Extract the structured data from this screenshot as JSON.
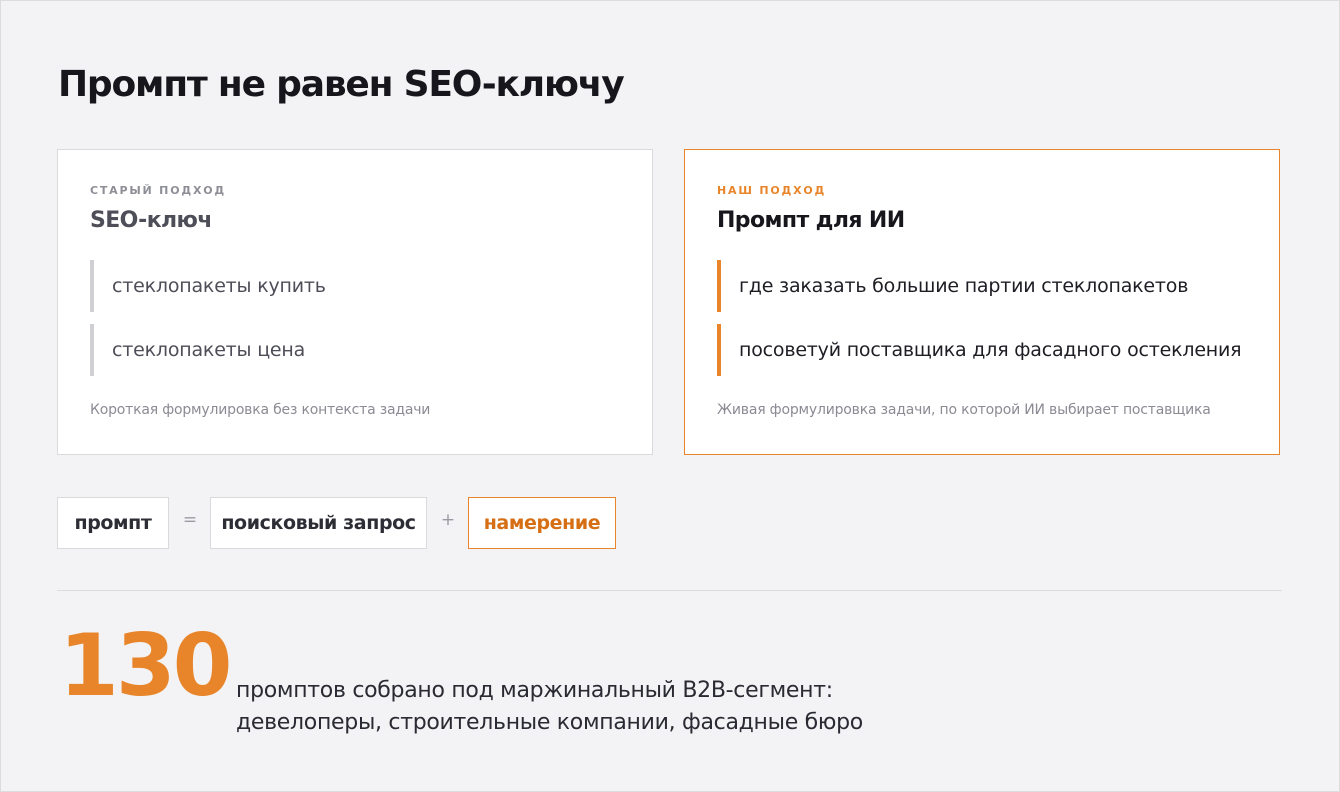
{
  "title": "Промпт не равен SEO-ключу",
  "old_approach": {
    "kicker": "СТАРЫЙ ПОДХОД",
    "title": "SEO-ключ",
    "examples": [
      "стеклопакеты купить",
      "стеклопакеты цена"
    ],
    "note": "Короткая формулировка без контекста задачи"
  },
  "new_approach": {
    "kicker": "НАШ ПОДХОД",
    "title": "Промпт для ИИ",
    "examples": [
      "где заказать большие партии стеклопакетов",
      "посоветуй поставщика для фасадного остекления"
    ],
    "note": "Живая формулировка задачи, по которой ИИ выбирает поставщика"
  },
  "formula": {
    "term1": "промпт",
    "op1": "=",
    "term2": "поисковый запрос",
    "op2": "+",
    "term3": "намерение"
  },
  "stat": {
    "number": "130",
    "line1": "промптов собрано под маржинальный B2B-сегмент:",
    "line2": "девелоперы, строительные компании, фасадные бюро"
  },
  "colors": {
    "accent": "#e8852a",
    "background": "#f3f3f5",
    "card": "#ffffff",
    "muted_border": "#cfcfd4"
  }
}
